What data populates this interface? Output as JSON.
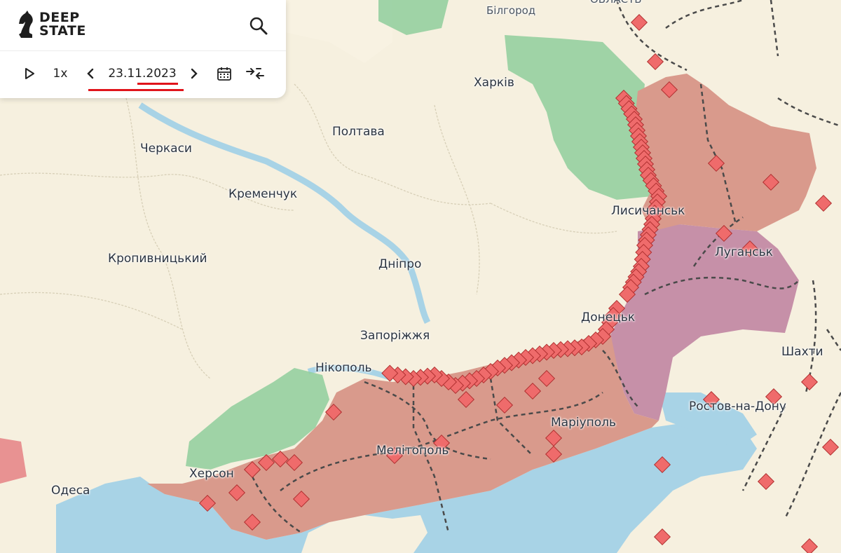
{
  "app": {
    "logo_line1": "DEEP",
    "logo_line2": "STATE"
  },
  "toolbar": {
    "play_icon": "play-icon",
    "speed": "1x",
    "prev_icon": "chevron-left-icon",
    "date": "23.11.2023",
    "next_icon": "chevron-right-icon",
    "calendar_icon": "calendar-icon",
    "compare_icon": "compare-arrows-icon",
    "search_icon": "search-icon"
  },
  "map": {
    "cities": [
      "Білгород",
      "Харків",
      "Полтава",
      "Черкаси",
      "Кременчук",
      "Кропивницький",
      "Дніпро",
      "Запоріжжя",
      "Нікополь",
      "Херсон",
      "Одеса",
      "Мелітополь",
      "Маріуполь",
      "Донецьк",
      "Лисичанськ",
      "Луганськ",
      "Шахти",
      "Ростов-на-Дону"
    ],
    "region_label_partial": "ОБЛАСТЬ",
    "colors": {
      "land": "#f6f0df",
      "water": "#a8d3e6",
      "occupied": "#d99a8c",
      "occupied_pre_2022": "#c690a8",
      "liberated": "#8fce9c",
      "markers": "#ef6b6b",
      "annotation_underline": "#e0141b"
    }
  }
}
